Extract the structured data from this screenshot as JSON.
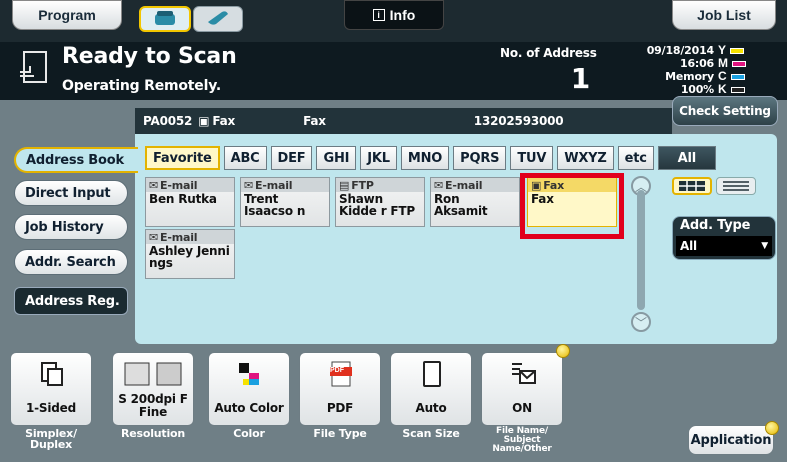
{
  "top": {
    "program": "Program",
    "info": "Info",
    "job_list": "Job List"
  },
  "status": {
    "title": "Ready to Scan",
    "subtitle": "Operating Remotely.",
    "no_of_address_label": "No. of Address",
    "no_of_address_value": "1",
    "date": "09/18/2014",
    "time": "16:06",
    "memory_label": "Memory",
    "memory_value": "100%",
    "check_setting": "Check Setting",
    "ink": [
      {
        "letter": "Y",
        "color": "#f6e200"
      },
      {
        "letter": "M",
        "color": "#e0147f"
      },
      {
        "letter": "C",
        "color": "#1aa0e0"
      },
      {
        "letter": "K",
        "color": "#222222"
      }
    ]
  },
  "destination": {
    "id": "PA0052",
    "type": "Fax",
    "name": "Fax",
    "number": "13202593000"
  },
  "side_tabs": [
    "Address Book",
    "Direct Input",
    "Job History",
    "Addr. Search"
  ],
  "address_reg": "Address Reg.",
  "index_tabs": [
    "Favorite",
    "ABC",
    "DEF",
    "GHI",
    "JKL",
    "MNO",
    "PQRS",
    "TUV",
    "WXYZ",
    "etc",
    "All"
  ],
  "address_cards": [
    {
      "type": "E-mail",
      "name": "Ben Rutka"
    },
    {
      "type": "E-mail",
      "name": "Trent Isaacso n"
    },
    {
      "type": "FTP",
      "name": "Shawn Kidde r FTP"
    },
    {
      "type": "E-mail",
      "name": "Ron Aksamit"
    },
    {
      "type": "Fax",
      "name": "Fax"
    },
    {
      "type": "E-mail",
      "name": "Ashley Jenni ngs"
    }
  ],
  "add_type": {
    "label": "Add. Type",
    "value": "All"
  },
  "functions": [
    {
      "value": "1-Sided",
      "label": "Simplex/ Duplex"
    },
    {
      "value": "S 200dpi F Fine",
      "label": "Resolution"
    },
    {
      "value": "Auto Color",
      "label": "Color"
    },
    {
      "value": "PDF",
      "label": "File Type"
    },
    {
      "value": "Auto",
      "label": "Scan Size"
    },
    {
      "value": "ON",
      "label": "File Name/ Subject Name/Other"
    }
  ],
  "application": "Application",
  "icons": {
    "pdf_badge": "PDF"
  }
}
